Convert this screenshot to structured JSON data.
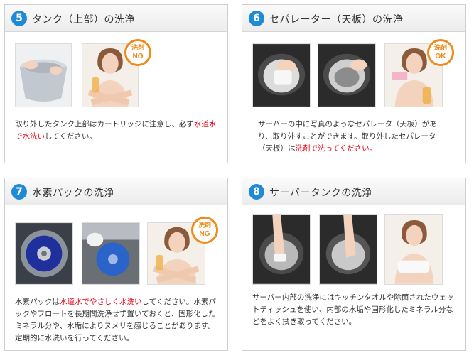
{
  "sections": [
    {
      "number": "5",
      "title": "タンク（上部）の洗浄",
      "desc": [
        "取り外したタンク上部はカートリッジに注意し、必ず",
        "水道水で水洗い",
        "してください。"
      ],
      "badge": {
        "line1": "洗剤",
        "line2": "NG"
      }
    },
    {
      "number": "6",
      "title": "セパレーター（天板）の洗浄",
      "desc": [
        "サーバーの中に写真のようなセパレータ（天板）があり、取り外すことができます。取り外したセパレータ（天板）は",
        "洗剤で洗ってください。",
        ""
      ],
      "badge": {
        "line1": "洗剤",
        "line2": "OK"
      }
    },
    {
      "number": "7",
      "title": "水素パックの洗浄",
      "desc": [
        "水素パックは",
        "水道水でやさしく水洗い",
        "してください。水素パックやフロートを長期間洗浄せず置いておくと、固形化したミネラル分や、水垢によりヌメリを感じることがあります。定期的に水洗いを行ってください。"
      ],
      "badge": {
        "line1": "洗剤",
        "line2": "NG"
      }
    },
    {
      "number": "8",
      "title": "サーバータンクの洗浄",
      "desc": [
        "サーバー内部の洗浄にはキッチンタオルや除菌されたウェットティッシュを使い、内部の水垢や固形化したミネラル分などをよく拭き取ってください。",
        "",
        ""
      ]
    }
  ],
  "icons": {
    "tank_photo": "tank-photo",
    "woman_photo": "woman-photo",
    "separator_photo": "separator-photo",
    "hydrogen_pack_photo": "hydrogen-pack-photo",
    "server_tank_photo": "server-tank-photo"
  },
  "colors": {
    "accent_blue": "#1f8ad6",
    "badge_orange": "#f08a19",
    "warning_red": "#e60012"
  }
}
